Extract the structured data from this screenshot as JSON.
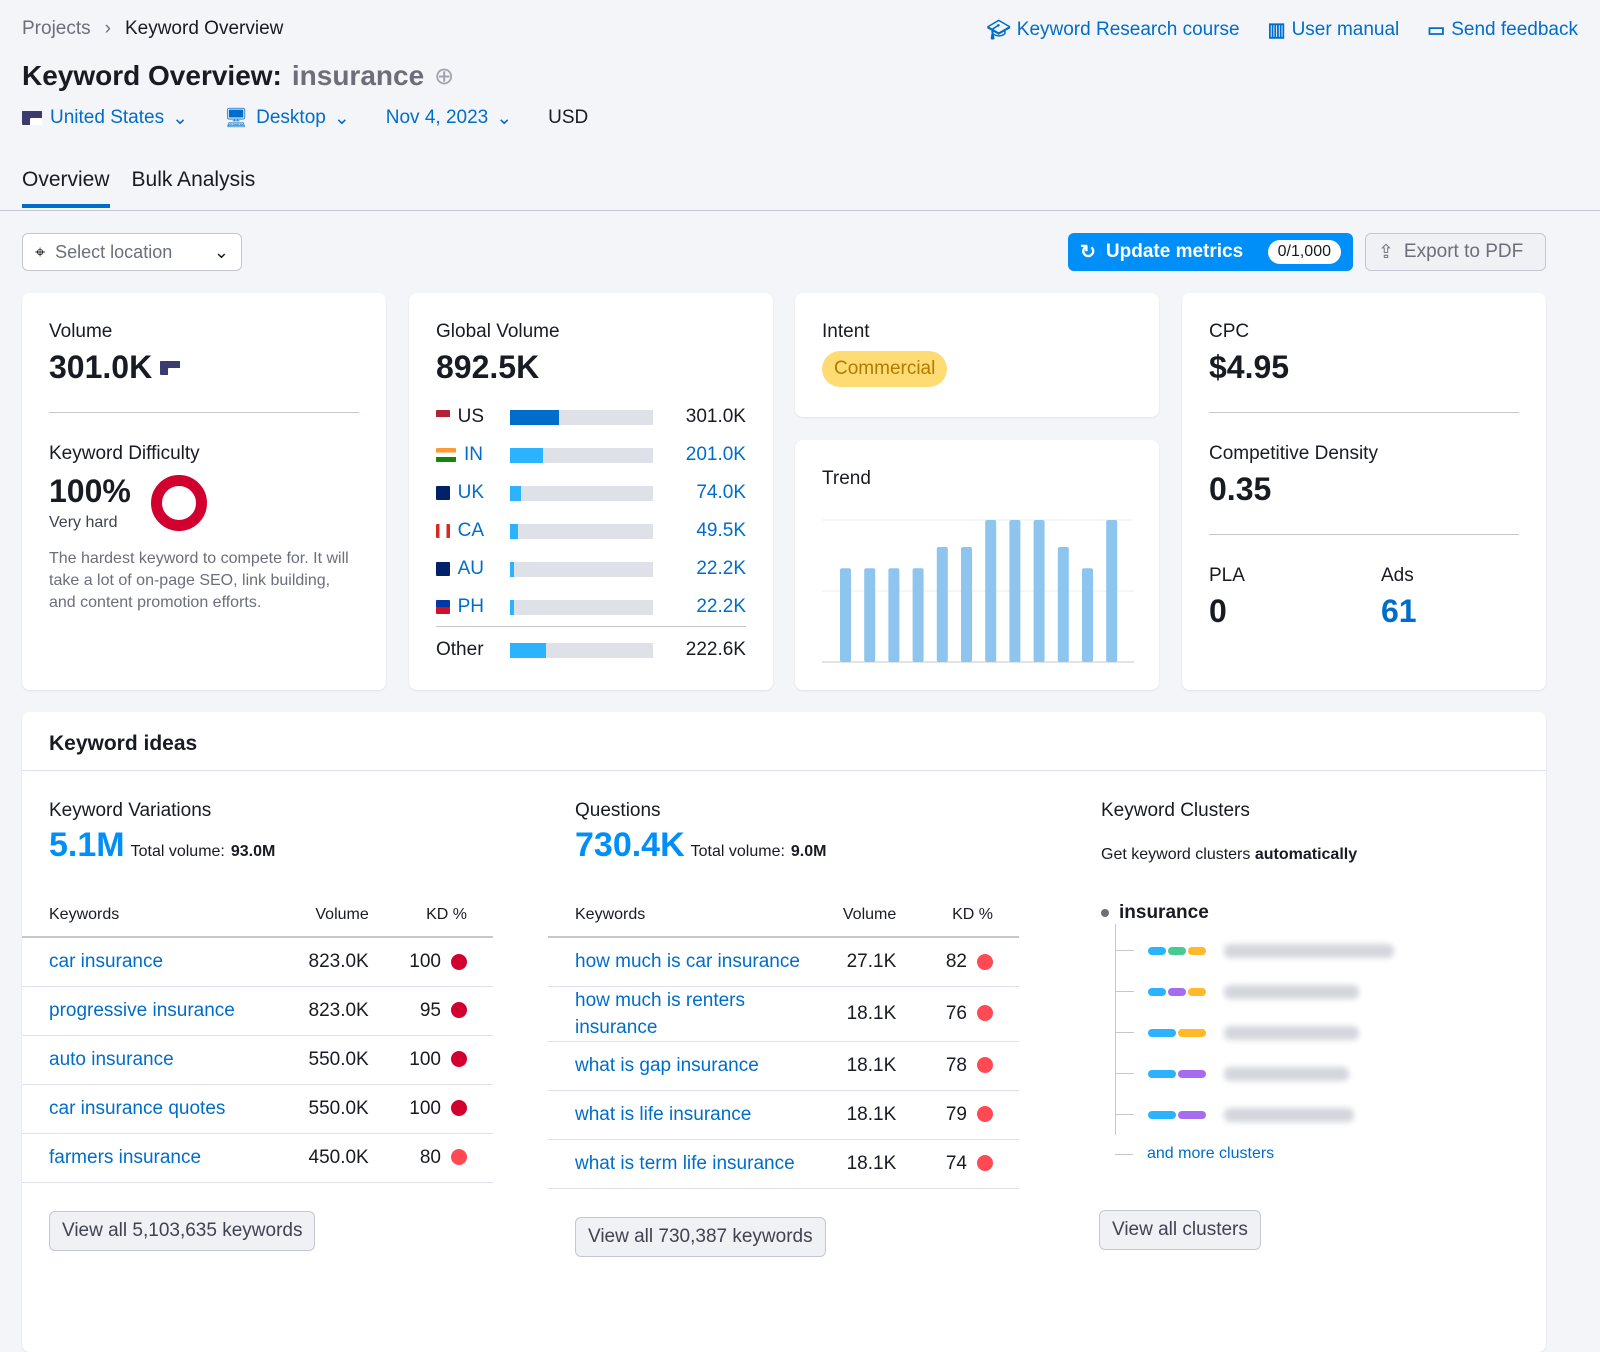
{
  "breadcrumb": [
    "Projects",
    "Keyword Overview"
  ],
  "top_links": [
    {
      "icon": "graduation-cap-icon",
      "label": "Keyword Research course"
    },
    {
      "icon": "book-icon",
      "label": "User manual"
    },
    {
      "icon": "chat-icon",
      "label": "Send feedback"
    }
  ],
  "title": {
    "prefix": "Keyword Overview:",
    "keyword": "insurance"
  },
  "filters": {
    "country": "United States",
    "device": "Desktop",
    "date": "Nov 4, 2023",
    "currency": "USD"
  },
  "tabs": [
    "Overview",
    "Bulk Analysis"
  ],
  "toolbar": {
    "location_placeholder": "Select location",
    "update_label": "Update metrics",
    "update_count": "0/1,000",
    "export_label": "Export to PDF"
  },
  "volume": {
    "label": "Volume",
    "value": "301.0K"
  },
  "difficulty": {
    "label": "Keyword Difficulty",
    "value": "100%",
    "level": "Very hard",
    "description": "The hardest keyword to compete for. It will take a lot of on-page SEO, link building, and content promotion efforts.",
    "color": "#d1002f"
  },
  "global_volume": {
    "label": "Global Volume",
    "value": "892.5K",
    "rows": [
      {
        "code": "US",
        "value": "301.0K",
        "share": 0.34,
        "color": "#006dca"
      },
      {
        "code": "IN",
        "value": "201.0K",
        "share": 0.23,
        "color": "#2bb3ff"
      },
      {
        "code": "UK",
        "value": "74.0K",
        "share": 0.08,
        "color": "#2bb3ff"
      },
      {
        "code": "CA",
        "value": "49.5K",
        "share": 0.055,
        "color": "#2bb3ff"
      },
      {
        "code": "AU",
        "value": "22.2K",
        "share": 0.025,
        "color": "#2bb3ff"
      },
      {
        "code": "PH",
        "value": "22.2K",
        "share": 0.025,
        "color": "#2bb3ff"
      }
    ],
    "other": {
      "label": "Other",
      "value": "222.6K",
      "share": 0.25
    }
  },
  "intent": {
    "label": "Intent",
    "value": "Commercial"
  },
  "trend": {
    "label": "Trend",
    "values": [
      0.66,
      0.66,
      0.66,
      0.66,
      0.81,
      0.81,
      1,
      1,
      1,
      0.81,
      0.66,
      1
    ],
    "color": "#8ec5ee"
  },
  "cpc": {
    "label": "CPC",
    "value": "$4.95"
  },
  "competitive_density": {
    "label": "Competitive Density",
    "value": "0.35"
  },
  "pla": {
    "label": "PLA",
    "value": "0"
  },
  "ads": {
    "label": "Ads",
    "value": "61"
  },
  "ideas": {
    "title": "Keyword ideas",
    "variations": {
      "label": "Keyword Variations",
      "count": "5.1M",
      "total_label": "Total volume:",
      "total": "93.0M",
      "headers": [
        "Keywords",
        "Volume",
        "KD %"
      ],
      "rows": [
        [
          "car insurance",
          "823.0K",
          "100",
          "#d1002f"
        ],
        [
          "progressive insurance",
          "823.0K",
          "95",
          "#d1002f"
        ],
        [
          "auto insurance",
          "550.0K",
          "100",
          "#d1002f"
        ],
        [
          "car insurance quotes",
          "550.0K",
          "100",
          "#d1002f"
        ],
        [
          "farmers insurance",
          "450.0K",
          "80",
          "#ff4953"
        ]
      ],
      "button": "View all 5,103,635 keywords"
    },
    "questions": {
      "label": "Questions",
      "count": "730.4K",
      "total_label": "Total volume:",
      "total": "9.0M",
      "headers": [
        "Keywords",
        "Volume",
        "KD %"
      ],
      "rows": [
        [
          "how much is car insurance",
          "27.1K",
          "82",
          "#ff4953"
        ],
        [
          "how much is renters insurance",
          "18.1K",
          "76",
          "#ff4953"
        ],
        [
          "what is gap insurance",
          "18.1K",
          "78",
          "#ff4953"
        ],
        [
          "what is life insurance",
          "18.1K",
          "79",
          "#ff4953"
        ],
        [
          "what is term life insurance",
          "18.1K",
          "74",
          "#ff4953"
        ]
      ],
      "button": "View all 730,387 keywords"
    },
    "clusters": {
      "label": "Keyword Clusters",
      "subtitle": "Get keyword clusters",
      "subtitle_bold": "automatically",
      "root": "insurance",
      "items": [
        [
          "#2bb3ff",
          "#45cc92",
          "#ffb92b"
        ],
        [
          "#2bb3ff",
          "#a56cf0",
          "#ffb92b"
        ],
        [
          "#2bb3ff",
          "#ffb92b"
        ],
        [
          "#2bb3ff",
          "#a56cf0"
        ],
        [
          "#2bb3ff",
          "#a56cf0"
        ]
      ],
      "more": "and more clusters",
      "button": "View all clusters"
    }
  }
}
